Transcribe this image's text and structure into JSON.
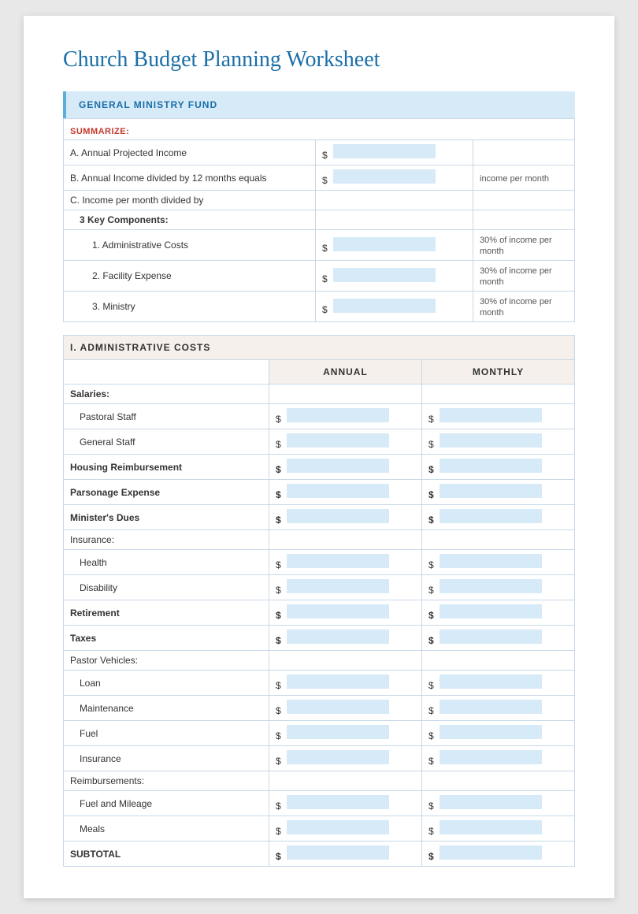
{
  "title": "Church Budget Planning Worksheet",
  "section1": {
    "header": "GENERAL MINISTRY FUND",
    "summarize_label": "SUMMARIZE:",
    "rows": [
      {
        "label": "A. Annual Projected Income",
        "has_input": true,
        "note": ""
      },
      {
        "label": "B. Annual Income divided by 12 months equals",
        "has_input": true,
        "note": "income per month"
      },
      {
        "label": "C. Income per month divided by",
        "has_input": false,
        "note": ""
      }
    ],
    "key_components_label": "3 Key Components:",
    "components": [
      {
        "label": "1. Administrative Costs",
        "has_input": true,
        "note": "30% of income per month"
      },
      {
        "label": "2. Facility Expense",
        "has_input": true,
        "note": "30% of income per month"
      },
      {
        "label": "3. Ministry",
        "has_input": true,
        "note": "30% of income per month"
      }
    ]
  },
  "section2": {
    "header": "I. ADMINISTRATIVE COSTS",
    "col_annual": "ANNUAL",
    "col_monthly": "MONTHLY",
    "groups": [
      {
        "group_label": "Salaries:",
        "is_bold": true,
        "items": [
          {
            "label": "Pastoral Staff",
            "has_annual": true,
            "has_monthly": true
          },
          {
            "label": "General Staff",
            "has_annual": true,
            "has_monthly": true
          }
        ]
      },
      {
        "group_label": "Housing Reimbursement",
        "is_bold": true,
        "items": [],
        "has_annual": true,
        "has_monthly": true
      },
      {
        "group_label": "Parsonage Expense",
        "is_bold": true,
        "items": [],
        "has_annual": true,
        "has_monthly": true
      },
      {
        "group_label": "Minister's Dues",
        "is_bold": true,
        "items": [],
        "has_annual": true,
        "has_monthly": true
      },
      {
        "group_label": "Insurance:",
        "is_bold": false,
        "items": [
          {
            "label": "Health",
            "has_annual": true,
            "has_monthly": true
          },
          {
            "label": "Disability",
            "has_annual": true,
            "has_monthly": true
          }
        ]
      },
      {
        "group_label": "Retirement",
        "is_bold": true,
        "items": [],
        "has_annual": true,
        "has_monthly": true
      },
      {
        "group_label": "Taxes",
        "is_bold": true,
        "items": [],
        "has_annual": true,
        "has_monthly": true
      },
      {
        "group_label": "Pastor Vehicles:",
        "is_bold": false,
        "items": [
          {
            "label": "Loan",
            "has_annual": true,
            "has_monthly": true
          },
          {
            "label": "Maintenance",
            "has_annual": true,
            "has_monthly": true
          },
          {
            "label": "Fuel",
            "has_annual": true,
            "has_monthly": true
          },
          {
            "label": "Insurance",
            "has_annual": true,
            "has_monthly": true
          }
        ]
      },
      {
        "group_label": "Reimbursements:",
        "is_bold": false,
        "items": [
          {
            "label": "Fuel and Mileage",
            "has_annual": true,
            "has_monthly": true
          },
          {
            "label": "Meals",
            "has_annual": true,
            "has_monthly": true
          }
        ]
      }
    ],
    "subtotal_label": "SUBTOTAL"
  }
}
